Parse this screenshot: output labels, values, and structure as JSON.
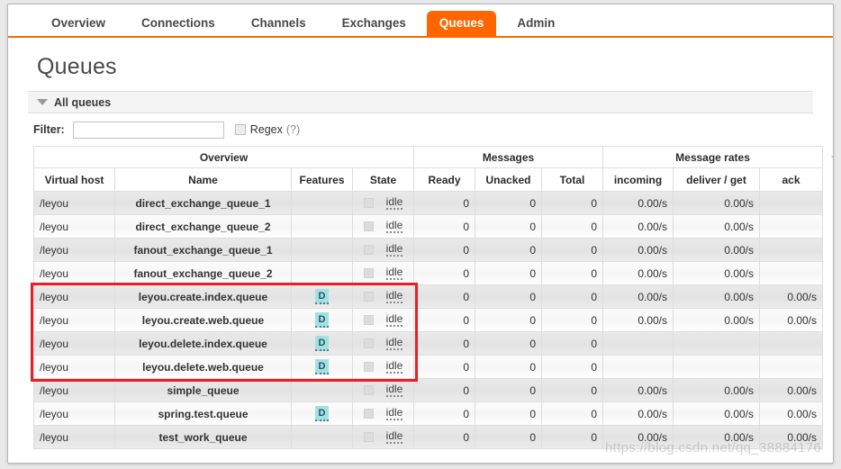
{
  "nav": {
    "tabs": [
      {
        "label": "Overview",
        "active": false
      },
      {
        "label": "Connections",
        "active": false
      },
      {
        "label": "Channels",
        "active": false
      },
      {
        "label": "Exchanges",
        "active": false
      },
      {
        "label": "Queues",
        "active": true
      },
      {
        "label": "Admin",
        "active": false
      }
    ],
    "accent_color": "#ff6600"
  },
  "page": {
    "title": "Queues",
    "section_label": "All queues",
    "collapse_icon": "triangle-down-icon"
  },
  "filter": {
    "label": "Filter:",
    "value": "",
    "placeholder": "",
    "regex_label": "Regex",
    "regex_help": "(?)",
    "regex_checked": false
  },
  "table": {
    "group_headers": [
      {
        "label": "Overview",
        "span": 4
      },
      {
        "label": "Messages",
        "span": 3
      },
      {
        "label": "Message rates",
        "span": 3
      }
    ],
    "columns": [
      {
        "key": "vhost",
        "label": "Virtual host",
        "bold": true
      },
      {
        "key": "name",
        "label": "Name",
        "bold": true
      },
      {
        "key": "features",
        "label": "Features",
        "bold": false
      },
      {
        "key": "state",
        "label": "State",
        "bold": true
      },
      {
        "key": "ready",
        "label": "Ready",
        "bold": true
      },
      {
        "key": "unacked",
        "label": "Unacked",
        "bold": true
      },
      {
        "key": "total",
        "label": "Total",
        "bold": true
      },
      {
        "key": "incoming",
        "label": "incoming",
        "bold": true
      },
      {
        "key": "deliver_get",
        "label": "deliver / get",
        "bold": true
      },
      {
        "key": "ack",
        "label": "ack",
        "bold": true
      }
    ],
    "toggle_columns_label": "+/",
    "state_badge_text": "idle",
    "feature_badge_text": "D",
    "feature_badge_color": "#a5e0e0",
    "rows": [
      {
        "vhost": "/leyou",
        "name": "direct_exchange_queue_1",
        "features": "",
        "state": "idle",
        "ready": "0",
        "unacked": "0",
        "total": "0",
        "incoming": "0.00/s",
        "deliver_get": "0.00/s",
        "ack": "",
        "highlighted": false
      },
      {
        "vhost": "/leyou",
        "name": "direct_exchange_queue_2",
        "features": "",
        "state": "idle",
        "ready": "0",
        "unacked": "0",
        "total": "0",
        "incoming": "0.00/s",
        "deliver_get": "0.00/s",
        "ack": "",
        "highlighted": false
      },
      {
        "vhost": "/leyou",
        "name": "fanout_exchange_queue_1",
        "features": "",
        "state": "idle",
        "ready": "0",
        "unacked": "0",
        "total": "0",
        "incoming": "0.00/s",
        "deliver_get": "0.00/s",
        "ack": "",
        "highlighted": false
      },
      {
        "vhost": "/leyou",
        "name": "fanout_exchange_queue_2",
        "features": "",
        "state": "idle",
        "ready": "0",
        "unacked": "0",
        "total": "0",
        "incoming": "0.00/s",
        "deliver_get": "0.00/s",
        "ack": "",
        "highlighted": false
      },
      {
        "vhost": "/leyou",
        "name": "leyou.create.index.queue",
        "features": "D",
        "state": "idle",
        "ready": "0",
        "unacked": "0",
        "total": "0",
        "incoming": "0.00/s",
        "deliver_get": "0.00/s",
        "ack": "0.00/s",
        "highlighted": true
      },
      {
        "vhost": "/leyou",
        "name": "leyou.create.web.queue",
        "features": "D",
        "state": "idle",
        "ready": "0",
        "unacked": "0",
        "total": "0",
        "incoming": "0.00/s",
        "deliver_get": "0.00/s",
        "ack": "0.00/s",
        "highlighted": true
      },
      {
        "vhost": "/leyou",
        "name": "leyou.delete.index.queue",
        "features": "D",
        "state": "idle",
        "ready": "0",
        "unacked": "0",
        "total": "0",
        "incoming": "",
        "deliver_get": "",
        "ack": "",
        "highlighted": true
      },
      {
        "vhost": "/leyou",
        "name": "leyou.delete.web.queue",
        "features": "D",
        "state": "idle",
        "ready": "0",
        "unacked": "0",
        "total": "0",
        "incoming": "",
        "deliver_get": "",
        "ack": "",
        "highlighted": true
      },
      {
        "vhost": "/leyou",
        "name": "simple_queue",
        "features": "",
        "state": "idle",
        "ready": "0",
        "unacked": "0",
        "total": "0",
        "incoming": "0.00/s",
        "deliver_get": "0.00/s",
        "ack": "0.00/s",
        "highlighted": false
      },
      {
        "vhost": "/leyou",
        "name": "spring.test.queue",
        "features": "D",
        "state": "idle",
        "ready": "0",
        "unacked": "0",
        "total": "0",
        "incoming": "0.00/s",
        "deliver_get": "0.00/s",
        "ack": "0.00/s",
        "highlighted": false
      },
      {
        "vhost": "/leyou",
        "name": "test_work_queue",
        "features": "",
        "state": "idle",
        "ready": "0",
        "unacked": "0",
        "total": "0",
        "incoming": "0.00/s",
        "deliver_get": "0.00/s",
        "ack": "0.00/s",
        "highlighted": false
      }
    ]
  },
  "watermark": {
    "text": "https://blog.csdn.net/qq_38884176"
  }
}
